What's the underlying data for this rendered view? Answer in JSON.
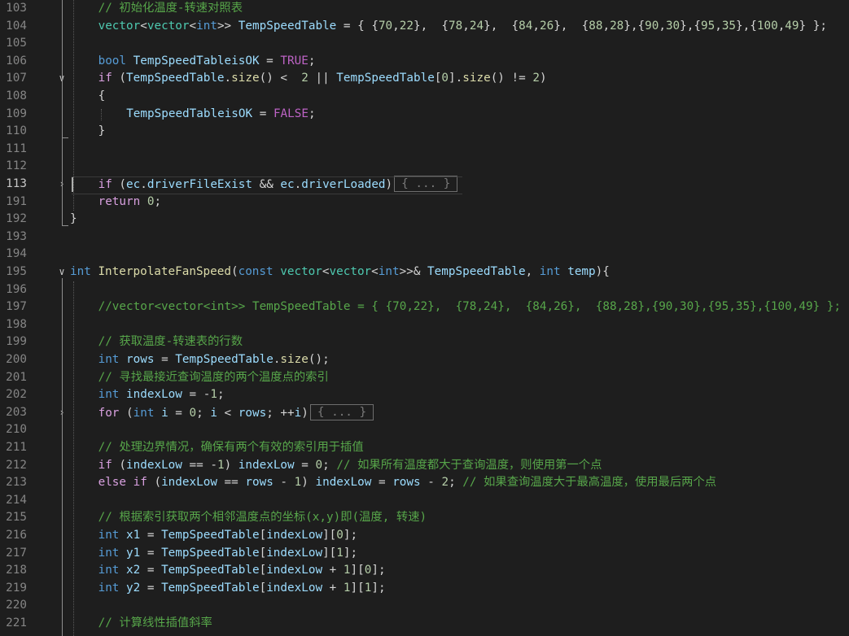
{
  "editor": {
    "language": "C++",
    "lines": [
      {
        "n": "103",
        "fold": "",
        "tokens": [
          [
            "cm",
            "// 初始化温度-转速对照表"
          ]
        ],
        "indent": 4
      },
      {
        "n": "104",
        "fold": "",
        "indent": 4,
        "tokens": [
          [
            "type",
            "vector"
          ],
          [
            "op",
            "<"
          ],
          [
            "type",
            "vector"
          ],
          [
            "op",
            "<"
          ],
          [
            "kw",
            "int"
          ],
          [
            "op",
            ">> "
          ],
          [
            "var",
            "TempSpeedTable"
          ],
          [
            "op",
            " = { {"
          ],
          [
            "num",
            "70"
          ],
          [
            "op",
            ","
          ],
          [
            "num",
            "22"
          ],
          [
            "op",
            "},  {"
          ],
          [
            "num",
            "78"
          ],
          [
            "op",
            ","
          ],
          [
            "num",
            "24"
          ],
          [
            "op",
            "},  {"
          ],
          [
            "num",
            "84"
          ],
          [
            "op",
            ","
          ],
          [
            "num",
            "26"
          ],
          [
            "op",
            "},  {"
          ],
          [
            "num",
            "88"
          ],
          [
            "op",
            ","
          ],
          [
            "num",
            "28"
          ],
          [
            "op",
            "},{"
          ],
          [
            "num",
            "90"
          ],
          [
            "op",
            ","
          ],
          [
            "num",
            "30"
          ],
          [
            "op",
            "},{"
          ],
          [
            "num",
            "95"
          ],
          [
            "op",
            ","
          ],
          [
            "num",
            "35"
          ],
          [
            "op",
            "},{"
          ],
          [
            "num",
            "100"
          ],
          [
            "op",
            ","
          ],
          [
            "num",
            "49"
          ],
          [
            "op",
            "} };"
          ]
        ]
      },
      {
        "n": "105",
        "fold": "",
        "indent": 4,
        "tokens": []
      },
      {
        "n": "106",
        "fold": "",
        "indent": 4,
        "tokens": [
          [
            "kw",
            "bool"
          ],
          [
            "op",
            " "
          ],
          [
            "var",
            "TempSpeedTableisOK"
          ],
          [
            "op",
            " = "
          ],
          [
            "macro",
            "TRUE"
          ],
          [
            "op",
            ";"
          ]
        ]
      },
      {
        "n": "107",
        "fold": "v",
        "indent": 4,
        "tokens": [
          [
            "ctl",
            "if"
          ],
          [
            "op",
            " ("
          ],
          [
            "var",
            "TempSpeedTable"
          ],
          [
            "op",
            "."
          ],
          [
            "fn",
            "size"
          ],
          [
            "op",
            "() <  "
          ],
          [
            "num",
            "2"
          ],
          [
            "op",
            " || "
          ],
          [
            "var",
            "TempSpeedTable"
          ],
          [
            "op",
            "["
          ],
          [
            "num",
            "0"
          ],
          [
            "op",
            "]."
          ],
          [
            "fn",
            "size"
          ],
          [
            "op",
            "() != "
          ],
          [
            "num",
            "2"
          ],
          [
            "op",
            ")"
          ]
        ]
      },
      {
        "n": "108",
        "fold": "",
        "indent": 4,
        "tokens": [
          [
            "op",
            "{"
          ]
        ]
      },
      {
        "n": "109",
        "fold": "",
        "indent": 8,
        "tokens": [
          [
            "var",
            "TempSpeedTableisOK"
          ],
          [
            "op",
            " = "
          ],
          [
            "macro",
            "FALSE"
          ],
          [
            "op",
            ";"
          ]
        ]
      },
      {
        "n": "110",
        "fold": "",
        "indent": 4,
        "tokens": [
          [
            "op",
            "}"
          ]
        ]
      },
      {
        "n": "111",
        "fold": "",
        "indent": 4,
        "tokens": []
      },
      {
        "n": "112",
        "fold": "",
        "indent": 4,
        "tokens": []
      },
      {
        "n": "113",
        "fold": ">",
        "indent": 4,
        "active": true,
        "tokens": [
          [
            "ctl",
            "if"
          ],
          [
            "op",
            " ("
          ],
          [
            "var",
            "ec"
          ],
          [
            "op",
            "."
          ],
          [
            "var",
            "driverFileExist"
          ],
          [
            "op",
            " && "
          ],
          [
            "var",
            "ec"
          ],
          [
            "op",
            "."
          ],
          [
            "var",
            "driverLoaded"
          ],
          [
            "op",
            ")"
          ],
          [
            "ellipsis",
            "{ ... }"
          ]
        ]
      },
      {
        "n": "191",
        "fold": "",
        "indent": 4,
        "tokens": [
          [
            "ctl",
            "return"
          ],
          [
            "op",
            " "
          ],
          [
            "num",
            "0"
          ],
          [
            "op",
            ";"
          ]
        ]
      },
      {
        "n": "192",
        "fold": "",
        "indent": 0,
        "tokens": [
          [
            "op",
            "}"
          ]
        ]
      },
      {
        "n": "193",
        "fold": "",
        "indent": 0,
        "tokens": []
      },
      {
        "n": "194",
        "fold": "",
        "indent": 0,
        "tokens": []
      },
      {
        "n": "195",
        "fold": "v",
        "indent": 0,
        "tokens": [
          [
            "kw",
            "int"
          ],
          [
            "op",
            " "
          ],
          [
            "fn",
            "InterpolateFanSpeed"
          ],
          [
            "op",
            "("
          ],
          [
            "kw",
            "const"
          ],
          [
            "op",
            " "
          ],
          [
            "type",
            "vector"
          ],
          [
            "op",
            "<"
          ],
          [
            "type",
            "vector"
          ],
          [
            "op",
            "<"
          ],
          [
            "kw",
            "int"
          ],
          [
            "op",
            ">>& "
          ],
          [
            "var",
            "TempSpeedTable"
          ],
          [
            "op",
            ", "
          ],
          [
            "kw",
            "int"
          ],
          [
            "op",
            " "
          ],
          [
            "var",
            "temp"
          ],
          [
            "op",
            "){"
          ]
        ]
      },
      {
        "n": "196",
        "fold": "",
        "indent": 4,
        "tokens": []
      },
      {
        "n": "197",
        "fold": "",
        "indent": 4,
        "tokens": [
          [
            "cm",
            "//vector<vector<int>> TempSpeedTable = { {70,22},  {78,24},  {84,26},  {88,28},{90,30},{95,35},{100,49} };"
          ]
        ]
      },
      {
        "n": "198",
        "fold": "",
        "indent": 4,
        "tokens": []
      },
      {
        "n": "199",
        "fold": "",
        "indent": 4,
        "tokens": [
          [
            "cm",
            "// 获取温度-转速表的行数"
          ]
        ]
      },
      {
        "n": "200",
        "fold": "",
        "indent": 4,
        "tokens": [
          [
            "kw",
            "int"
          ],
          [
            "op",
            " "
          ],
          [
            "var",
            "rows"
          ],
          [
            "op",
            " = "
          ],
          [
            "var",
            "TempSpeedTable"
          ],
          [
            "op",
            "."
          ],
          [
            "fn",
            "size"
          ],
          [
            "op",
            "();"
          ]
        ]
      },
      {
        "n": "201",
        "fold": "",
        "indent": 4,
        "tokens": [
          [
            "cm",
            "// 寻找最接近查询温度的两个温度点的索引"
          ]
        ]
      },
      {
        "n": "202",
        "fold": "",
        "indent": 4,
        "tokens": [
          [
            "kw",
            "int"
          ],
          [
            "op",
            " "
          ],
          [
            "var",
            "indexLow"
          ],
          [
            "op",
            " = -"
          ],
          [
            "num",
            "1"
          ],
          [
            "op",
            ";"
          ]
        ]
      },
      {
        "n": "203",
        "fold": ">",
        "indent": 4,
        "tokens": [
          [
            "ctl",
            "for"
          ],
          [
            "op",
            " ("
          ],
          [
            "kw",
            "int"
          ],
          [
            "op",
            " "
          ],
          [
            "var",
            "i"
          ],
          [
            "op",
            " = "
          ],
          [
            "num",
            "0"
          ],
          [
            "op",
            "; "
          ],
          [
            "var",
            "i"
          ],
          [
            "op",
            " < "
          ],
          [
            "var",
            "rows"
          ],
          [
            "op",
            "; ++"
          ],
          [
            "var",
            "i"
          ],
          [
            "op",
            ")"
          ],
          [
            "ellipsis",
            "{ ... }"
          ]
        ]
      },
      {
        "n": "210",
        "fold": "",
        "indent": 4,
        "tokens": []
      },
      {
        "n": "211",
        "fold": "",
        "indent": 4,
        "tokens": [
          [
            "cm",
            "// 处理边界情况，确保有两个有效的索引用于插值"
          ]
        ]
      },
      {
        "n": "212",
        "fold": "",
        "indent": 4,
        "tokens": [
          [
            "ctl",
            "if"
          ],
          [
            "op",
            " ("
          ],
          [
            "var",
            "indexLow"
          ],
          [
            "op",
            " == -"
          ],
          [
            "num",
            "1"
          ],
          [
            "op",
            ") "
          ],
          [
            "var",
            "indexLow"
          ],
          [
            "op",
            " = "
          ],
          [
            "num",
            "0"
          ],
          [
            "op",
            "; "
          ],
          [
            "cm",
            "// 如果所有温度都大于查询温度，则使用第一个点"
          ]
        ]
      },
      {
        "n": "213",
        "fold": "",
        "indent": 4,
        "tokens": [
          [
            "ctl",
            "else if"
          ],
          [
            "op",
            " ("
          ],
          [
            "var",
            "indexLow"
          ],
          [
            "op",
            " == "
          ],
          [
            "var",
            "rows"
          ],
          [
            "op",
            " - "
          ],
          [
            "num",
            "1"
          ],
          [
            "op",
            ") "
          ],
          [
            "var",
            "indexLow"
          ],
          [
            "op",
            " = "
          ],
          [
            "var",
            "rows"
          ],
          [
            "op",
            " - "
          ],
          [
            "num",
            "2"
          ],
          [
            "op",
            "; "
          ],
          [
            "cm",
            "// 如果查询温度大于最高温度，使用最后两个点"
          ]
        ]
      },
      {
        "n": "214",
        "fold": "",
        "indent": 4,
        "tokens": []
      },
      {
        "n": "215",
        "fold": "",
        "indent": 4,
        "tokens": [
          [
            "cm",
            "// 根据索引获取两个相邻温度点的坐标(x,y)即(温度, 转速)"
          ]
        ]
      },
      {
        "n": "216",
        "fold": "",
        "indent": 4,
        "tokens": [
          [
            "kw",
            "int"
          ],
          [
            "op",
            " "
          ],
          [
            "var",
            "x1"
          ],
          [
            "op",
            " = "
          ],
          [
            "var",
            "TempSpeedTable"
          ],
          [
            "op",
            "["
          ],
          [
            "var",
            "indexLow"
          ],
          [
            "op",
            "]["
          ],
          [
            "num",
            "0"
          ],
          [
            "op",
            "];"
          ]
        ]
      },
      {
        "n": "217",
        "fold": "",
        "indent": 4,
        "tokens": [
          [
            "kw",
            "int"
          ],
          [
            "op",
            " "
          ],
          [
            "var",
            "y1"
          ],
          [
            "op",
            " = "
          ],
          [
            "var",
            "TempSpeedTable"
          ],
          [
            "op",
            "["
          ],
          [
            "var",
            "indexLow"
          ],
          [
            "op",
            "]["
          ],
          [
            "num",
            "1"
          ],
          [
            "op",
            "];"
          ]
        ]
      },
      {
        "n": "218",
        "fold": "",
        "indent": 4,
        "tokens": [
          [
            "kw",
            "int"
          ],
          [
            "op",
            " "
          ],
          [
            "var",
            "x2"
          ],
          [
            "op",
            " = "
          ],
          [
            "var",
            "TempSpeedTable"
          ],
          [
            "op",
            "["
          ],
          [
            "var",
            "indexLow"
          ],
          [
            "op",
            " + "
          ],
          [
            "num",
            "1"
          ],
          [
            "op",
            "]["
          ],
          [
            "num",
            "0"
          ],
          [
            "op",
            "];"
          ]
        ]
      },
      {
        "n": "219",
        "fold": "",
        "indent": 4,
        "tokens": [
          [
            "kw",
            "int"
          ],
          [
            "op",
            " "
          ],
          [
            "var",
            "y2"
          ],
          [
            "op",
            " = "
          ],
          [
            "var",
            "TempSpeedTable"
          ],
          [
            "op",
            "["
          ],
          [
            "var",
            "indexLow"
          ],
          [
            "op",
            " + "
          ],
          [
            "num",
            "1"
          ],
          [
            "op",
            "]["
          ],
          [
            "num",
            "1"
          ],
          [
            "op",
            "];"
          ]
        ]
      },
      {
        "n": "220",
        "fold": "",
        "indent": 4,
        "tokens": []
      },
      {
        "n": "221",
        "fold": "",
        "indent": 4,
        "tokens": [
          [
            "cm",
            "// 计算线性插值斜率"
          ]
        ]
      }
    ]
  }
}
